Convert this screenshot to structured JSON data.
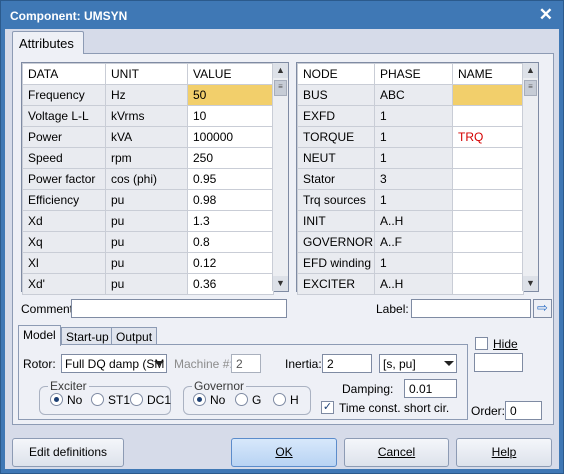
{
  "window": {
    "title": "Component: UMSYN"
  },
  "main_tab": {
    "label": "Attributes"
  },
  "data_table": {
    "headers": [
      "DATA",
      "UNIT",
      "VALUE"
    ],
    "rows": [
      {
        "data": "Frequency",
        "unit": "Hz",
        "value": "50"
      },
      {
        "data": "Voltage L-L",
        "unit": "kVrms",
        "value": "10"
      },
      {
        "data": "Power",
        "unit": "kVA",
        "value": "100000"
      },
      {
        "data": "Speed",
        "unit": "rpm",
        "value": "250"
      },
      {
        "data": "Power factor",
        "unit": "cos (phi)",
        "value": "0.95"
      },
      {
        "data": "Efficiency",
        "unit": "pu",
        "value": "0.98"
      },
      {
        "data": "Xd",
        "unit": "pu",
        "value": "1.3"
      },
      {
        "data": "Xq",
        "unit": "pu",
        "value": "0.8"
      },
      {
        "data": "Xl",
        "unit": "pu",
        "value": "0.12"
      },
      {
        "data": "Xd'",
        "unit": "pu",
        "value": "0.36"
      }
    ]
  },
  "node_table": {
    "headers": [
      "NODE",
      "PHASE",
      "NAME"
    ],
    "rows": [
      {
        "node": "BUS",
        "phase": "ABC",
        "name": ""
      },
      {
        "node": "EXFD",
        "phase": "1",
        "name": ""
      },
      {
        "node": "TORQUE",
        "phase": "1",
        "name": "TRQ"
      },
      {
        "node": "NEUT",
        "phase": "1",
        "name": ""
      },
      {
        "node": "Stator",
        "phase": "3",
        "name": ""
      },
      {
        "node": "Trq sources",
        "phase": "1",
        "name": ""
      },
      {
        "node": "INIT",
        "phase": "A..H",
        "name": ""
      },
      {
        "node": "GOVERNOR",
        "phase": "A..F",
        "name": ""
      },
      {
        "node": "EFD winding",
        "phase": "1",
        "name": ""
      },
      {
        "node": "EXCITER",
        "phase": "A..H",
        "name": ""
      }
    ]
  },
  "comment": {
    "label": "Comment:",
    "value": ""
  },
  "label_field": {
    "label": "Label:",
    "value": ""
  },
  "sub_tabs": [
    "Model",
    "Start-up",
    "Output"
  ],
  "model": {
    "rotor_label": "Rotor:",
    "rotor_value": "Full DQ damp (SM",
    "machine_label": "Machine #:",
    "machine_value": "2",
    "inertia_label": "Inertia:",
    "inertia_value": "2",
    "inertia_unit": "[s, pu]",
    "damping_label": "Damping:",
    "damping_value": "0.01",
    "timeconst_label": "Time const. short cir.",
    "exciter": {
      "legend": "Exciter",
      "options": [
        "No",
        "ST1",
        "DC1"
      ]
    },
    "governor": {
      "legend": "Governor",
      "options": [
        "No",
        "G",
        "H"
      ]
    }
  },
  "hide": {
    "label": "Hide",
    "value": ""
  },
  "order": {
    "label": "Order:",
    "value": "0"
  },
  "buttons": {
    "edit": "Edit definitions",
    "ok": "OK",
    "cancel": "Cancel",
    "help": "Help"
  }
}
